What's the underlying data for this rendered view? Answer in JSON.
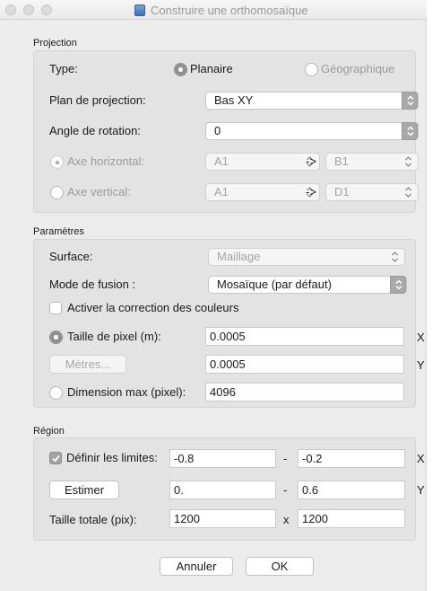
{
  "window": {
    "title": "Construire une orthomosaïque"
  },
  "projection": {
    "section_label": "Projection",
    "type_label": "Type:",
    "type_options": [
      "Planaire",
      "Géographique"
    ],
    "type_selected": "Planaire",
    "plan_label": "Plan de projection:",
    "plan_value": "Bas XY",
    "angle_label": "Angle de rotation:",
    "angle_value": "0",
    "axe_h_label": "Axe horizontal:",
    "axe_h_from": "A1",
    "axe_h_to": "B1",
    "axe_v_label": "Axe vertical:",
    "axe_v_from": "A1",
    "axe_v_to": "D1",
    "arrow": "->"
  },
  "parametres": {
    "section_label": "Paramètres",
    "surface_label": "Surface:",
    "surface_value": "Maillage",
    "fusion_label": "Mode de fusion :",
    "fusion_value": "Mosaïque (par défaut)",
    "color_correction_label": "Activer la correction des couleurs",
    "color_correction_checked": false,
    "pixel_size_label": "Taille de pixel (m):",
    "pixel_size_x": "0.0005",
    "pixel_size_y": "0.0005",
    "metres_button": "Mètres...",
    "max_dim_label": "Dimension max (pixel):",
    "max_dim_value": "4096",
    "axis_x": "X",
    "axis_y": "Y"
  },
  "region": {
    "section_label": "Région",
    "define_limits_label": "Définir les limites:",
    "define_limits_checked": true,
    "x_min": "-0.8",
    "x_max": "-0.2",
    "estimer_button": "Estimer",
    "y_min": "0.",
    "y_max": "0.6",
    "total_size_label": "Taille totale (pix):",
    "total_w": "1200",
    "total_h": "1200",
    "times": "x",
    "dash": "-",
    "axis_x": "X",
    "axis_y": "Y"
  },
  "buttons": {
    "cancel": "Annuler",
    "ok": "OK"
  },
  "icons": {
    "close": "close-icon",
    "minimize": "minimize-icon",
    "zoom": "zoom-icon",
    "app": "app-icon",
    "updown": "chevron-updown-icon",
    "check": "checkmark-icon"
  }
}
